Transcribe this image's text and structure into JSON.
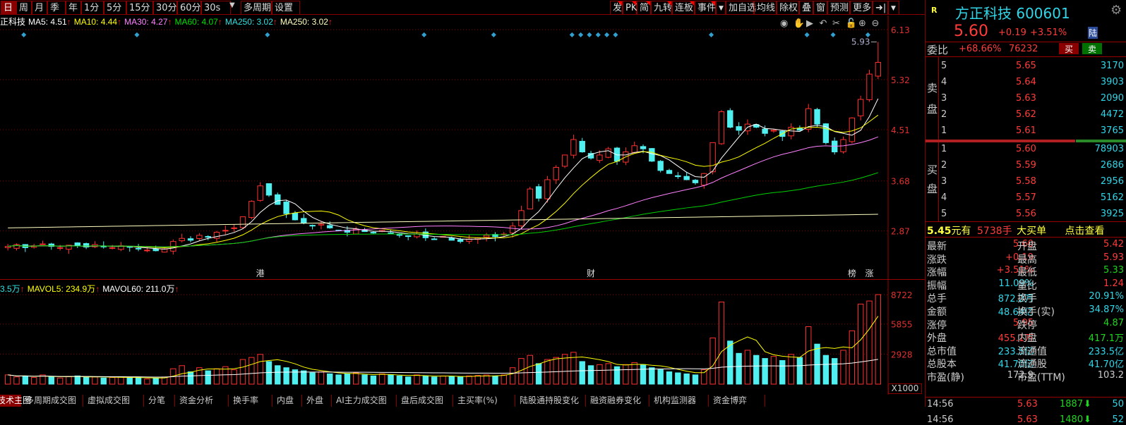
{
  "toolbar": {
    "periods": [
      "日",
      "周",
      "月",
      "季",
      "年",
      "1分",
      "5分",
      "15分",
      "30分",
      "60分",
      "30s",
      "多周期",
      "设置"
    ],
    "tools": [
      "发",
      "PK",
      "简",
      "九转",
      "连板",
      "事件",
      "加自选",
      "均线",
      "除权",
      "叠",
      "窗",
      "预测",
      "更多"
    ]
  },
  "legend": {
    "stock": "正科技",
    "ma": [
      {
        "label": "MA5: 4.51",
        "color": "#ffffff"
      },
      {
        "label": "MA10: 4.44",
        "color": "#ffff00"
      },
      {
        "label": "MA30: 4.27",
        "color": "#ff80ff"
      },
      {
        "label": "MA60: 4.07",
        "color": "#00e000"
      },
      {
        "label": "MA250: 3.02",
        "color": "#30e0e0"
      },
      {
        "label": "MA250: 3.02",
        "color": "#ffffc0"
      }
    ],
    "arrow": "↑"
  },
  "vol_legend": [
    {
      "label": "3.5万",
      "color": "#30e0e0"
    },
    {
      "label": "MAVOL5: 234.9万",
      "color": "#ffff00"
    },
    {
      "label": "MAVOL60: 211.0万",
      "color": "#ffffff"
    }
  ],
  "chart_data": {
    "type": "candlestick",
    "price_ticks": [
      "6.13",
      "5.32",
      "4.51",
      "3.68",
      "2.87"
    ],
    "price_tick_values": [
      6.13,
      5.32,
      4.51,
      3.68,
      2.87
    ],
    "vol_ticks": [
      "8722",
      "5855",
      "2928"
    ],
    "vol_tick_values": [
      8722,
      5855,
      2928
    ],
    "vol_unit": "X1000",
    "high_label": "5.93",
    "closes": [
      2.62,
      2.65,
      2.6,
      2.63,
      2.66,
      2.62,
      2.6,
      2.64,
      2.63,
      2.61,
      2.65,
      2.62,
      2.6,
      2.63,
      2.61,
      2.58,
      2.56,
      2.55,
      2.58,
      2.7,
      2.75,
      2.72,
      2.8,
      2.78,
      2.85,
      2.88,
      2.92,
      3.1,
      3.35,
      3.6,
      3.45,
      3.3,
      3.15,
      3.05,
      3.0,
      2.95,
      2.98,
      2.92,
      2.88,
      2.85,
      2.9,
      2.86,
      2.84,
      2.88,
      2.83,
      2.8,
      2.78,
      2.82,
      2.76,
      2.74,
      2.78,
      2.72,
      2.7,
      2.74,
      2.76,
      2.8,
      2.78,
      2.82,
      2.95,
      3.2,
      3.55,
      3.4,
      3.7,
      3.9,
      4.1,
      4.35,
      4.15,
      4.05,
      4.1,
      4.2,
      4.0,
      4.15,
      4.25,
      4.2,
      4.0,
      3.85,
      3.8,
      3.75,
      3.7,
      3.65,
      3.8,
      4.3,
      4.8,
      4.55,
      4.5,
      4.6,
      4.55,
      4.45,
      4.5,
      4.4,
      4.55,
      4.5,
      4.85,
      4.6,
      4.3,
      4.15,
      4.35,
      4.7,
      5.0,
      5.41,
      5.6
    ],
    "volumes": [
      900,
      700,
      800,
      650,
      900,
      700,
      600,
      750,
      800,
      650,
      700,
      600,
      650,
      700,
      600,
      650,
      500,
      550,
      700,
      1500,
      1800,
      1200,
      1600,
      1300,
      1500,
      1700,
      1400,
      2400,
      2600,
      2900,
      2200,
      1800,
      1600,
      1400,
      1300,
      1100,
      1200,
      1000,
      900,
      1000,
      1100,
      900,
      800,
      1000,
      900,
      800,
      700,
      900,
      800,
      700,
      800,
      750,
      700,
      800,
      850,
      900,
      800,
      900,
      1600,
      2500,
      2800,
      2000,
      2400,
      2600,
      2900,
      3100,
      2200,
      1800,
      1900,
      2000,
      1700,
      1900,
      2100,
      1900,
      1600,
      1400,
      1200,
      1100,
      1000,
      900,
      1400,
      4500,
      8000,
      4200,
      3000,
      3300,
      2800,
      2500,
      2700,
      2300,
      2900,
      2600,
      5600,
      3900,
      2800,
      2500,
      3300,
      5200,
      7800,
      8100,
      8722
    ],
    "event_labels": [
      "港",
      "财",
      "榜",
      "涨"
    ]
  },
  "right": {
    "badge": "R",
    "name": "方正科技",
    "code": "600601",
    "price": "5.60",
    "change": "+0.19",
    "pct": "+3.51%",
    "market": "陆",
    "weibi_label": "委比",
    "weibi": "+68.66%",
    "weicha": "76232",
    "buy": "买",
    "sell": "卖",
    "sell_label": [
      "卖",
      "盘"
    ],
    "buy_label": [
      "买",
      "盘"
    ],
    "asks": [
      {
        "n": "5",
        "p": "5.65",
        "v": "3170"
      },
      {
        "n": "4",
        "p": "5.64",
        "v": "3903"
      },
      {
        "n": "3",
        "p": "5.63",
        "v": "2090"
      },
      {
        "n": "2",
        "p": "5.62",
        "v": "4472"
      },
      {
        "n": "1",
        "p": "5.61",
        "v": "3765"
      }
    ],
    "bids": [
      {
        "n": "1",
        "p": "5.60",
        "v": "78903"
      },
      {
        "n": "2",
        "p": "5.59",
        "v": "2686"
      },
      {
        "n": "3",
        "p": "5.58",
        "v": "2956"
      },
      {
        "n": "4",
        "p": "5.57",
        "v": "5162"
      },
      {
        "n": "5",
        "p": "5.56",
        "v": "3925"
      }
    ],
    "bigorder": {
      "price": "5.45",
      "you": "元有",
      "qty": "5738手",
      "type": "大买单",
      "link": "点击查看"
    },
    "stats": [
      {
        "l1": "最新",
        "v1": "5.60",
        "c1": "red",
        "l2": "开盘",
        "v2": "5.42",
        "c2": "red"
      },
      {
        "l1": "涨跌",
        "v1": "+0.19",
        "c1": "red",
        "l2": "最高",
        "v2": "5.93",
        "c2": "red"
      },
      {
        "l1": "涨幅",
        "v1": "+3.51%",
        "c1": "red",
        "l2": "最低",
        "v2": "5.33",
        "c2": "green"
      },
      {
        "l1": "振幅",
        "v1": "11.09%",
        "c1": "cyan",
        "l2": "量比",
        "v2": "1.24",
        "c2": "red"
      },
      {
        "l1": "总手",
        "v1": "872.2万",
        "c1": "cyan",
        "l2": "换手",
        "v2": "20.91%",
        "c2": "cyan"
      },
      {
        "l1": "金额",
        "v1": "48.64亿",
        "c1": "cyan",
        "l2": "换手(实)",
        "v2": "34.87%",
        "c2": "cyan"
      },
      {
        "l1": "涨停",
        "v1": "5.95",
        "c1": "red",
        "l2": "跌停",
        "v2": "4.87",
        "c2": "green"
      },
      {
        "l1": "外盘",
        "v1": "455.1万",
        "c1": "red",
        "l2": "内盘",
        "v2": "417.1万",
        "c2": "green"
      },
      {
        "l1": "总市值",
        "v1": "233.5亿",
        "c1": "cyan",
        "l2": "流通值",
        "v2": "233.5亿",
        "c2": "cyan"
      },
      {
        "l1": "总股本",
        "v1": "41.70亿",
        "c1": "cyan",
        "l2": "流通股",
        "v2": "41.70亿",
        "c2": "cyan"
      },
      {
        "l1": "市盈(静)",
        "v1": "172.9",
        "c1": "gray",
        "l2": "市盈(TTM)",
        "v2": "103.2",
        "c2": "gray"
      }
    ],
    "ticks": [
      {
        "t": "14:56",
        "p": "5.63",
        "v": "1887",
        "dir": "down",
        "n": "50"
      },
      {
        "t": "14:56",
        "p": "5.63",
        "v": "1480",
        "dir": "down",
        "n": "52"
      }
    ]
  },
  "bottom_tabs": [
    "技术主图",
    "多周期成交图",
    "虚拟成交图",
    "分笔",
    "资金分析",
    "换手率",
    "内盘",
    "外盘",
    "AI主力成交图",
    "盘后成交图",
    "主买率(%)",
    "陆股通持股变化",
    "融资融券变化",
    "机构监测器",
    "资金博弈"
  ]
}
